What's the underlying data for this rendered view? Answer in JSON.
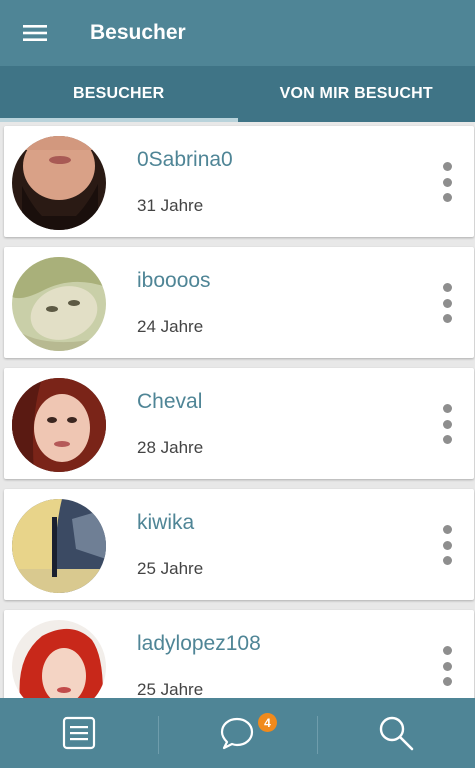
{
  "header": {
    "title": "Besucher",
    "menu_icon": "hamburger-menu-icon"
  },
  "tabs": [
    {
      "label": "BESUCHER",
      "active": true
    },
    {
      "label": "VON MIR BESUCHT",
      "active": false
    }
  ],
  "visitors": [
    {
      "name": "0Sabrina0",
      "age": "31 Jahre"
    },
    {
      "name": "iboooos",
      "age": "24 Jahre"
    },
    {
      "name": "Cheval",
      "age": "28 Jahre"
    },
    {
      "name": "kiwika",
      "age": "25 Jahre"
    },
    {
      "name": "ladylopez108",
      "age": "25 Jahre"
    }
  ],
  "bottom_nav": {
    "items": [
      "list-icon",
      "chat-bubble-icon",
      "search-icon"
    ],
    "messages_badge": "4"
  },
  "colors": {
    "primary": "#4f8596",
    "tab_bar": "#3f7486",
    "badge": "#f08a1c"
  }
}
